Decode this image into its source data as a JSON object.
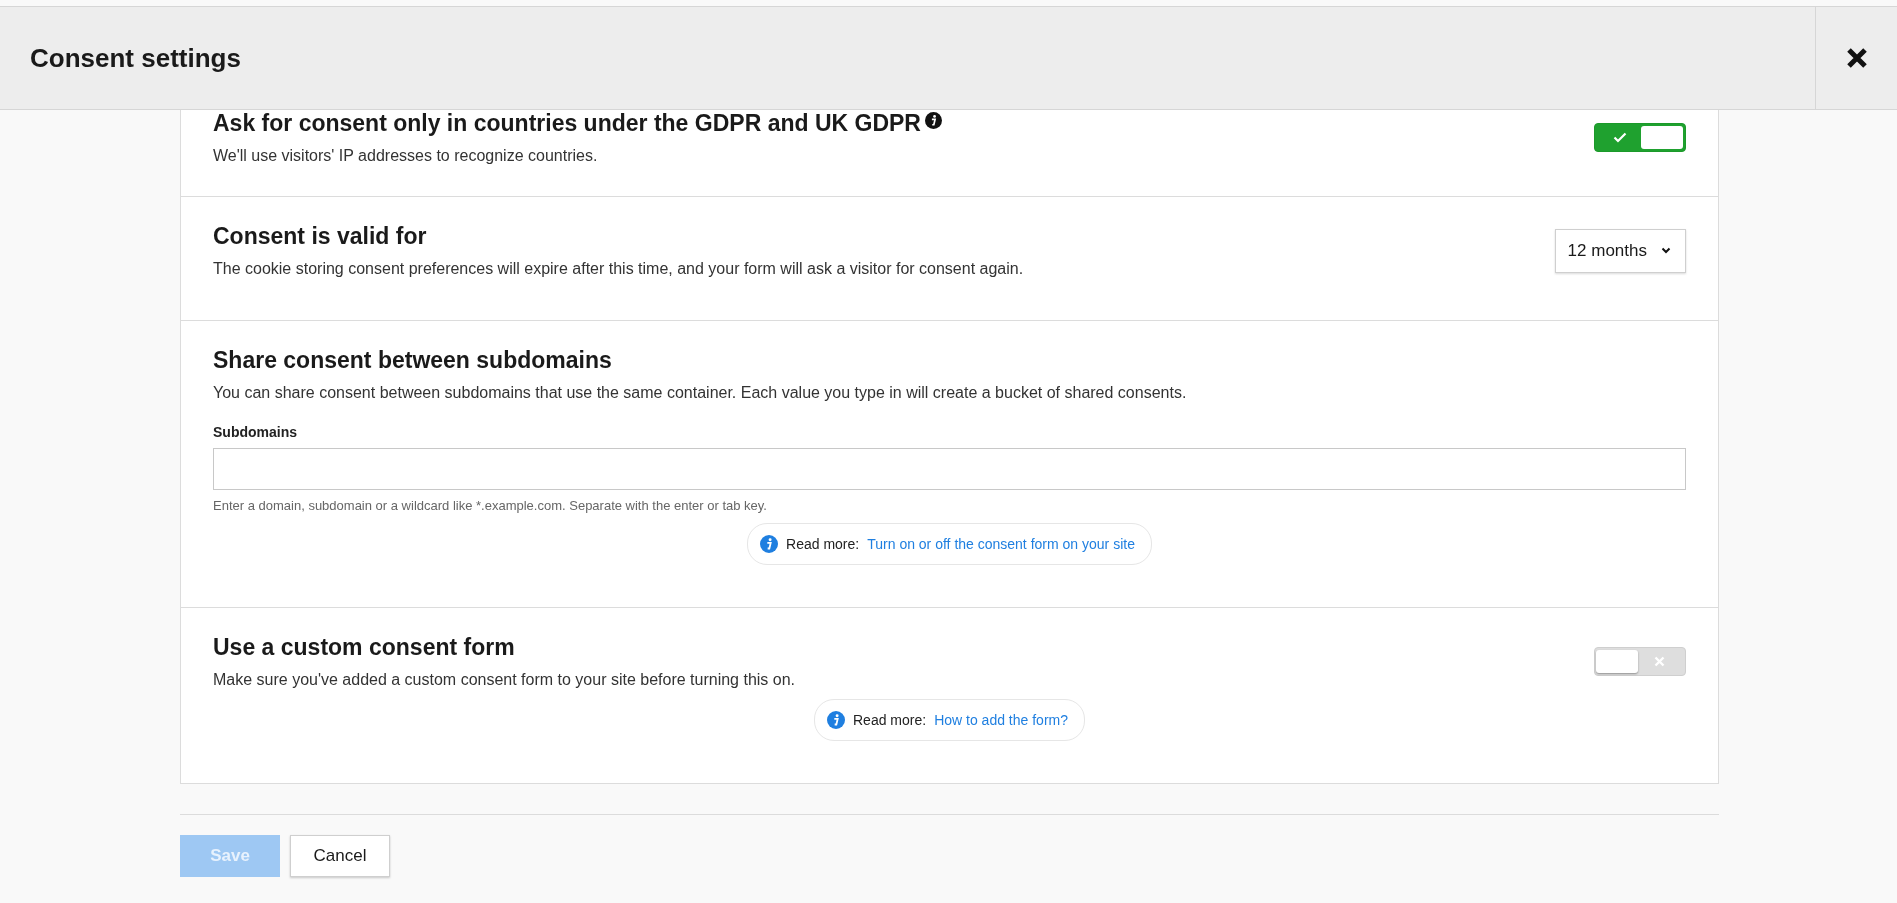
{
  "dialog": {
    "title": "Consent settings"
  },
  "sections": [
    {
      "kind": "toggle",
      "title": "Ask for consent only in countries under the GDPR and UK GDPR",
      "info_icon": true,
      "description": "We'll use visitors' IP addresses to recognize countries.",
      "on": true
    },
    {
      "kind": "select",
      "title": "Consent is valid for",
      "description": "The cookie storing consent preferences will expire after this time, and your form will ask a visitor for consent again.",
      "value": "12 months"
    },
    {
      "kind": "input",
      "title": "Share consent between subdomains",
      "description": "You can share consent between subdomains that use the same container. Each value you type in will create a bucket of shared consents.",
      "field_label": "Subdomains",
      "hint": "Enter a domain, subdomain or a wildcard like *.example.com. Separate with the enter or tab key.",
      "read_more": {
        "label": "Read more:",
        "link": "Turn on or off the consent form on your site"
      }
    },
    {
      "kind": "toggle",
      "title": "Use a custom consent form",
      "description": "Make sure you've added a custom consent form to your site before turning this on.",
      "on": false,
      "read_more": {
        "label": "Read more:",
        "link": "How to add the form?"
      }
    }
  ],
  "buttons": [
    {
      "label": "Save",
      "kind": "primary",
      "disabled": true
    },
    {
      "label": "Cancel",
      "kind": "secondary",
      "disabled": false
    }
  ]
}
